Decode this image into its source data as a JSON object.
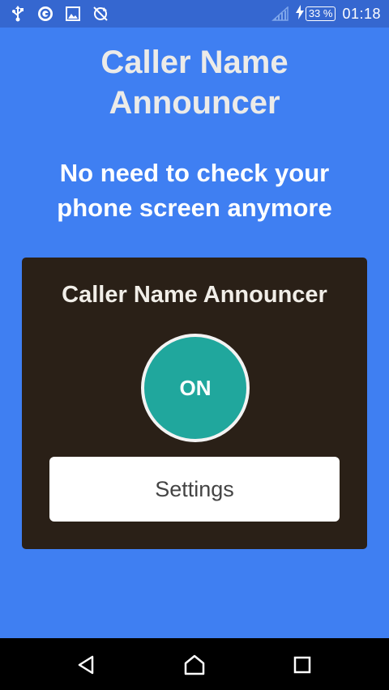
{
  "status_bar": {
    "icons": [
      "usb-icon",
      "app-notification-icon",
      "image-icon",
      "no-sync-icon"
    ],
    "signal_icon": "signal-icon",
    "charging_icon": "charging-icon",
    "battery": "33 %",
    "time": "01:18"
  },
  "app": {
    "title_line1": "Caller Name",
    "title_line2": "Announcer",
    "tagline_line1": "No need to check your",
    "tagline_line2": "phone screen anymore"
  },
  "card": {
    "title": "Caller Name Announcer",
    "toggle_label": "ON",
    "settings_label": "Settings"
  },
  "nav": {
    "back": "back-icon",
    "home": "home-icon",
    "recents": "recents-icon"
  },
  "colors": {
    "background": "#3f7ff2",
    "status_bar": "#3567d0",
    "card": "#2a2017",
    "toggle": "#20a79d"
  }
}
